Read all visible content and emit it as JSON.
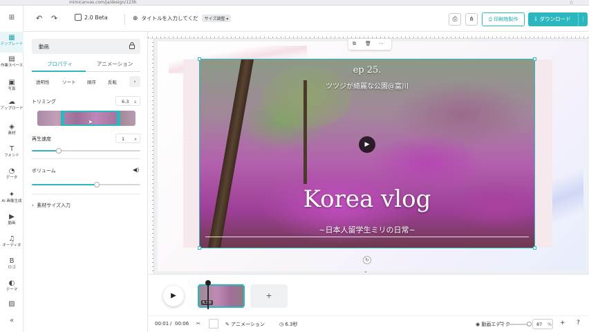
{
  "browser": {
    "url": "mimicanvas.com/ja/design/123h"
  },
  "toolbar": {
    "version": "2.0 Beta",
    "title_placeholder": "タイトルを入力してくだ",
    "size_adjust": "サイズ調整",
    "print_label": "印刷物製作",
    "download_label": "ダウンロード"
  },
  "rail": {
    "items": [
      {
        "icon": "▦",
        "label": "テンプレート"
      },
      {
        "icon": "▤",
        "label": "作業スペース"
      },
      {
        "icon": "▣",
        "label": "写真"
      },
      {
        "icon": "☁",
        "label": "アップロード"
      },
      {
        "icon": "◈",
        "label": "素材"
      },
      {
        "icon": "T",
        "label": "フォント"
      },
      {
        "icon": "◔",
        "label": "データ"
      },
      {
        "icon": "✦",
        "label": "AI 画像生成"
      },
      {
        "icon": "▶",
        "label": "動画"
      },
      {
        "icon": "♫",
        "label": "オーディオ"
      },
      {
        "icon": "B",
        "label": "ロゴ"
      },
      {
        "icon": "◐",
        "label": "テーマ"
      }
    ]
  },
  "panel": {
    "header": "動画",
    "tabs": [
      "プロパティ",
      "アニメーション"
    ],
    "subtabs": [
      "透明性",
      "ソート",
      "順序",
      "反転"
    ],
    "trimming_label": "トリミング",
    "trimming_value": "6.3",
    "trimming_unit": "s",
    "trimming_fraction": 0.6,
    "speed_label": "再生速度",
    "speed_value": "1",
    "speed_unit": "x",
    "speed_fraction": 0.25,
    "volume_label": "ボリューム",
    "volume_fraction": 0.6,
    "expand_label": "素材サイズ入力"
  },
  "design": {
    "episode": "ep 25.",
    "subtitle": "ツツジが綺麗な公園@富川",
    "title": "Korea vlog",
    "bottom_subtitle": "~日本人留学生ミリの日常~"
  },
  "timeline": {
    "clip_duration": "6.3秒"
  },
  "statusbar": {
    "current_time": "00:01",
    "separator": "/",
    "total_time": "00:06",
    "animation_label": "アニメーション",
    "duration_label": "6.3秒",
    "video_editor_label": "動画エディタ",
    "zoom_value": "87",
    "zoom_unit": "%"
  },
  "colors": {
    "accent": "#2ab7bf"
  }
}
